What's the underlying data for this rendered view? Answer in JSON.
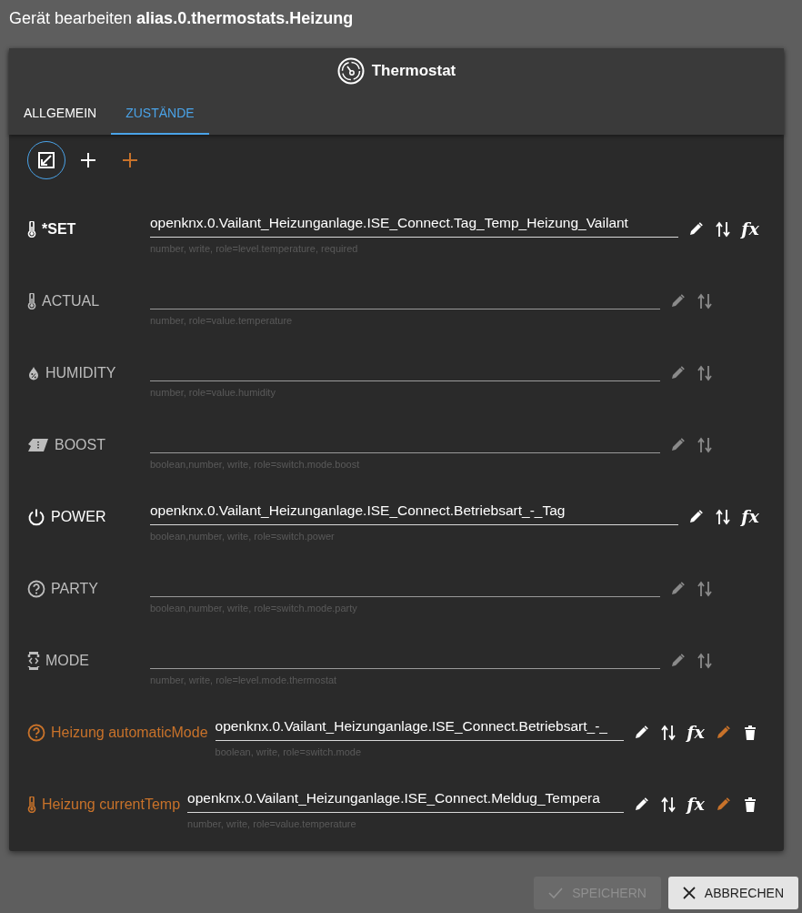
{
  "dialog_title": "Gerät bearbeiten **alias.0.thermostats.Heizung**",
  "device": {
    "title": "Thermostat"
  },
  "tabs": [
    {
      "label": "ALLGEMEIN",
      "selected": false
    },
    {
      "label": "ZUSTÄNDE",
      "selected": true
    }
  ],
  "toolbar": [
    {
      "kind": "expand",
      "selected": true
    },
    {
      "kind": "add",
      "selected": false
    },
    {
      "kind": "add_custom",
      "selected": false
    }
  ],
  "states": [
    {
      "kind": "standard",
      "label": "*SET",
      "required": true,
      "value": "openknx.0.Vailant_Heizunganlage.ISE_Connect.Tag_Temp_Heizung_Vailant",
      "formula": "fx",
      "hint": "number, write, role=level.temperature, required"
    },
    {
      "kind": "standard",
      "label": "ACTUAL",
      "required": false,
      "hint": "number, role=value.temperature"
    },
    {
      "kind": "standard",
      "label": "HUMIDITY",
      "required": false,
      "hint": "number, role=value.humidity"
    },
    {
      "kind": "standard",
      "label": "BOOST",
      "required": false,
      "hint": "boolean,number, write, role=switch.mode.boost"
    },
    {
      "kind": "standard",
      "label": "POWER",
      "required": false,
      "value": "openknx.0.Vailant_Heizunganlage.ISE_Connect.Betriebsart_-_Tag",
      "formula": "fx",
      "hint": "boolean,number, write, role=switch.power"
    },
    {
      "kind": "standard",
      "label": "PARTY",
      "required": false,
      "hint": "boolean,number, write, role=switch.mode.party"
    },
    {
      "kind": "standard",
      "label": "MODE",
      "required": false,
      "hint": "number, write, role=level.mode.thermostat"
    },
    {
      "kind": "custom",
      "label": "Heizung automaticMode",
      "required": false,
      "value": "openknx.0.Vailant_Heizunganlage.ISE_Connect.Betriebsart_-_",
      "formula": "fx",
      "hint": "boolean, write, role=switch.mode"
    },
    {
      "kind": "custom",
      "label": "Heizung currentTemp",
      "required": false,
      "value": "openknx.0.Vailant_Heizunganlage.ISE_Connect.Meldug_Tempera",
      "formula": "fx",
      "hint": "number, write, role=value.temperature"
    }
  ],
  "buttons": [
    {
      "label": "SPEICHERN",
      "kind": "save",
      "disabled": true
    },
    {
      "label": "ABBRECHEN",
      "kind": "cancel",
      "disabled": false
    }
  ]
}
